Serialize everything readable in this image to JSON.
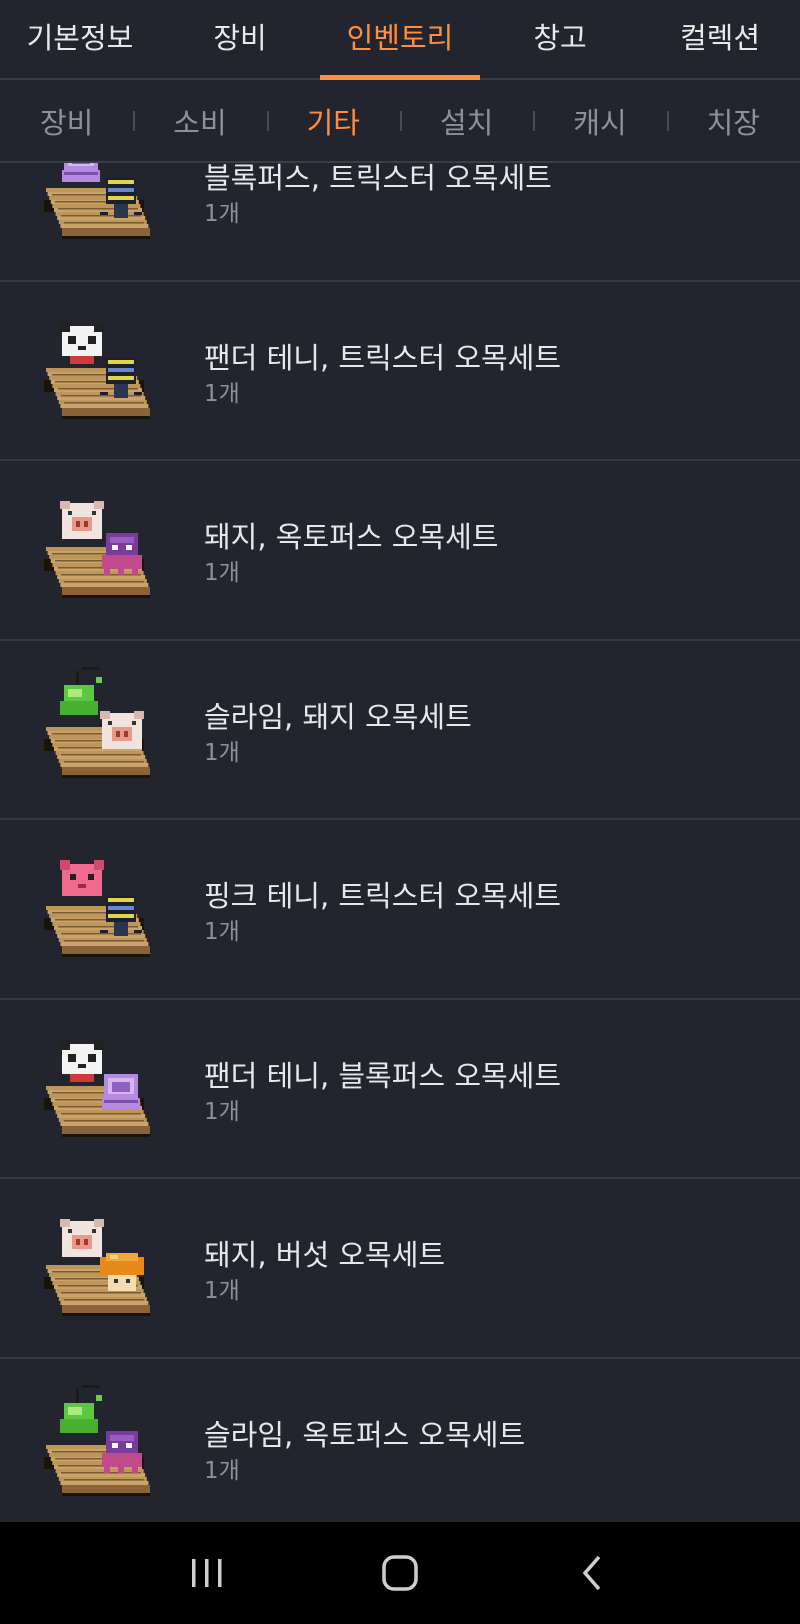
{
  "top_tabs": [
    {
      "label": "기본정보",
      "active": false
    },
    {
      "label": "장비",
      "active": false
    },
    {
      "label": "인벤토리",
      "active": true
    },
    {
      "label": "창고",
      "active": false
    },
    {
      "label": "컬렉션",
      "active": false
    }
  ],
  "sub_tabs": [
    {
      "label": "장비",
      "active": false
    },
    {
      "label": "소비",
      "active": false
    },
    {
      "label": "기타",
      "active": true
    },
    {
      "label": "설치",
      "active": false
    },
    {
      "label": "캐시",
      "active": false
    },
    {
      "label": "치장",
      "active": false
    }
  ],
  "items": [
    {
      "name": "블록퍼스, 트릭스터 오목세트",
      "count": "1개",
      "icon": "omok-set-icon",
      "pieces": [
        "blockpus",
        "trickster"
      ]
    },
    {
      "name": "팬더 테니, 트릭스터 오목세트",
      "count": "1개",
      "icon": "omok-set-icon",
      "pieces": [
        "panda",
        "trickster"
      ]
    },
    {
      "name": "돼지, 옥토퍼스 오목세트",
      "count": "1개",
      "icon": "omok-set-icon",
      "pieces": [
        "pig",
        "octopus"
      ]
    },
    {
      "name": "슬라임, 돼지 오목세트",
      "count": "1개",
      "icon": "omok-set-icon",
      "pieces": [
        "slime",
        "pig"
      ]
    },
    {
      "name": "핑크 테니, 트릭스터 오목세트",
      "count": "1개",
      "icon": "omok-set-icon",
      "pieces": [
        "pink",
        "trickster"
      ]
    },
    {
      "name": "팬더 테니, 블록퍼스 오목세트",
      "count": "1개",
      "icon": "omok-set-icon",
      "pieces": [
        "panda",
        "blockpus"
      ]
    },
    {
      "name": "돼지, 버섯 오목세트",
      "count": "1개",
      "icon": "omok-set-icon",
      "pieces": [
        "pig",
        "mushroom"
      ]
    },
    {
      "name": "슬라임, 옥토퍼스 오목세트",
      "count": "1개",
      "icon": "omok-set-icon",
      "pieces": [
        "slime",
        "octopus"
      ]
    }
  ],
  "nav": {
    "recent_icon": "recent-apps-icon",
    "home_icon": "home-icon",
    "back_icon": "back-icon"
  },
  "colors": {
    "background": "#22252e",
    "accent": "#ff8f3f",
    "divider": "#353944",
    "secondary_text": "#8c9099"
  }
}
